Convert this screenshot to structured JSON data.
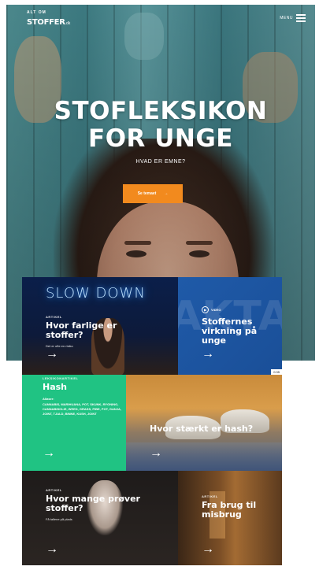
{
  "header": {
    "logo_small": "ALT OM",
    "logo_big": "STOFFER",
    "logo_tld": ".dk",
    "menu_label": "MENU"
  },
  "hero": {
    "title_line1": "STOFLEKSIKON",
    "title_line2": "FOR UNGE",
    "subtitle": "HVAD ER EMNE?",
    "cta_label": "Se temaet",
    "cta_arrow": "→"
  },
  "cards": [
    {
      "kicker": "ARTIKEL",
      "title": "Hvor farlige er stoffer?",
      "description": "Det er ofte en risiko",
      "neon_text": "SLOW DOWN",
      "arrow": "→"
    },
    {
      "badge": "VIDEO",
      "title": "Stoffernes virkning på unge",
      "arrow": "→",
      "duration": "0:35",
      "bg_text": "FAKTA"
    },
    {
      "kicker": "LEKSIKONARTIKEL",
      "title": "Hash",
      "alias_heading": "Aliaser:",
      "aliases": "CANNABIS, MARIHUANA, POT, SKUNK, RYGNING, CANNABISOLIE, WEED, GRASS, PIBE, POT, GANJA, JOINT, TJALD, BINNE, KUSH, JOINT",
      "arrow": "→"
    },
    {
      "title": "Hvor stærkt er hash?",
      "arrow": "→"
    },
    {
      "kicker": "ARTIKEL",
      "title": "Hvor mange prøver stoffer?",
      "description": "Få tallene på plads",
      "arrow": "→"
    },
    {
      "kicker": "ARTIKEL",
      "title": "Fra brug til misbrug",
      "arrow": "→"
    }
  ],
  "colors": {
    "accent_orange": "#f28a1e",
    "card_green": "#20c383",
    "card_blue": "#1f5aa8"
  }
}
